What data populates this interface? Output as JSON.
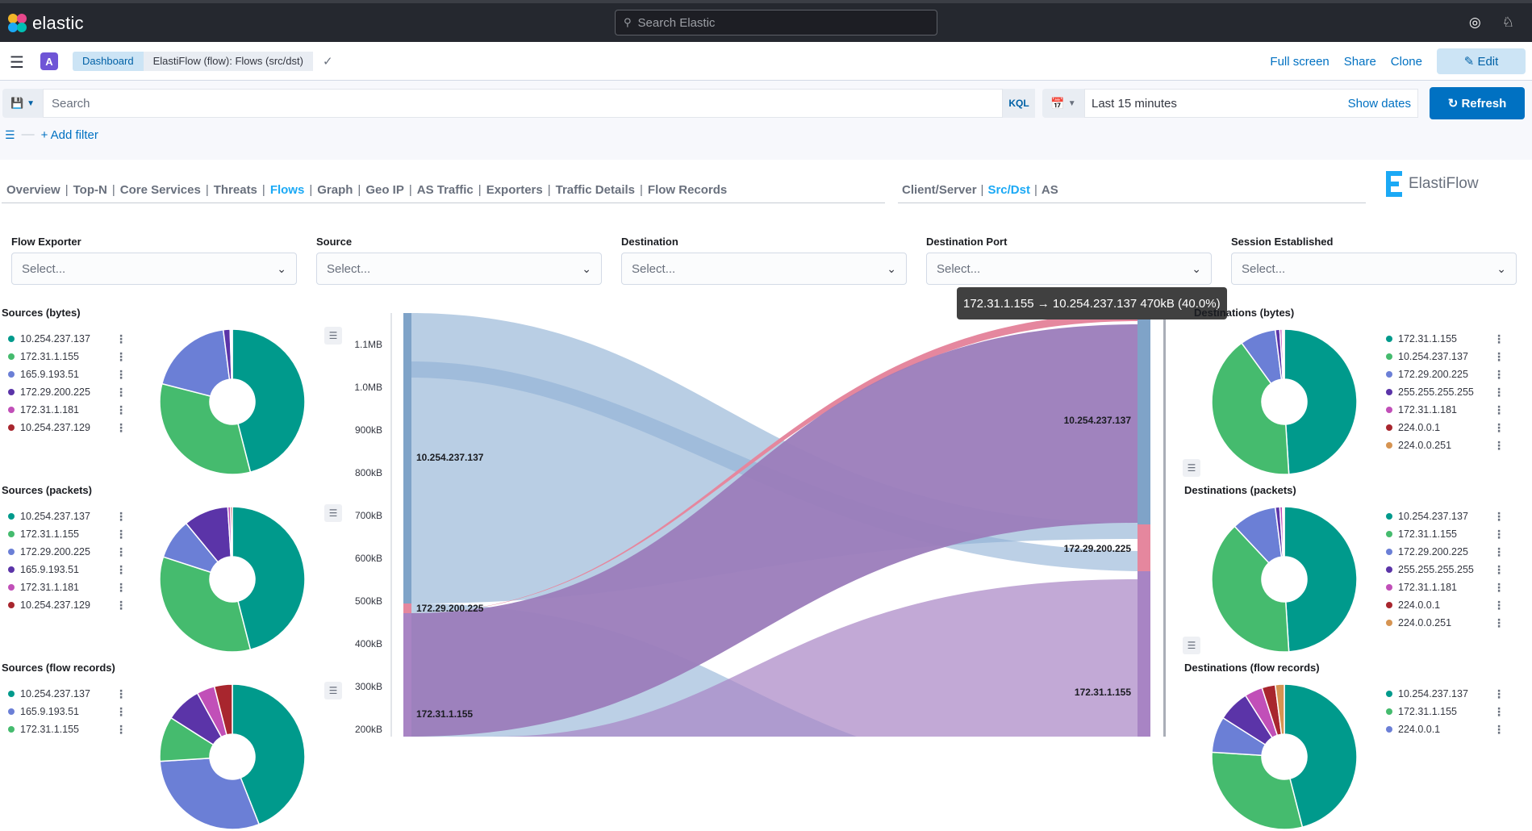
{
  "app": {
    "name": "elastic",
    "search_placeholder": "Search Elastic"
  },
  "header": {
    "space": "A",
    "breadcrumbs": [
      "Dashboard",
      "ElastiFlow (flow): Flows (src/dst)"
    ],
    "actions": {
      "fullscreen": "Full screen",
      "share": "Share",
      "clone": "Clone",
      "edit": "Edit"
    }
  },
  "query": {
    "placeholder": "Search",
    "language": "KQL",
    "time_range": "Last 15 minutes",
    "show_dates": "Show dates",
    "refresh": "Refresh",
    "add_filter": "+ Add filter"
  },
  "nav": {
    "tabs": [
      "Overview",
      "Top-N",
      "Core Services",
      "Threats",
      "Flows",
      "Graph",
      "Geo IP",
      "AS Traffic",
      "Exporters",
      "Traffic Details",
      "Flow Records"
    ],
    "active_tab": "Flows",
    "sub_tabs": [
      "Client/Server",
      "Src/Dst",
      "AS"
    ],
    "active_sub_tab": "Src/Dst",
    "brand": "ElastiFlow"
  },
  "controls": [
    {
      "label": "Flow Exporter",
      "value": "Select..."
    },
    {
      "label": "Source",
      "value": "Select..."
    },
    {
      "label": "Destination",
      "value": "Select..."
    },
    {
      "label": "Destination Port",
      "value": "Select..."
    },
    {
      "label": "Session Established",
      "value": "Select..."
    }
  ],
  "colors": {
    "teal": "#009a8c",
    "green": "#45bb6e",
    "blue": "#6b7fd6",
    "purple": "#5b34a8",
    "magenta": "#c14fb8",
    "darkred": "#a8262e",
    "orange": "#d69452",
    "accent": "#0071c2",
    "sankey_blue": "#b5cbe3",
    "sankey_purple": "#9b7cba",
    "sankey_pink": "#e5879e"
  },
  "left_panels": {
    "bytes": {
      "title": "Sources (bytes)",
      "items": [
        {
          "label": "10.254.237.137",
          "color": "#009a8c",
          "value": 46
        },
        {
          "label": "172.31.1.155",
          "color": "#45bb6e",
          "value": 33
        },
        {
          "label": "165.9.193.51",
          "color": "#6b7fd6",
          "value": 19
        },
        {
          "label": "172.29.200.225",
          "color": "#5b34a8",
          "value": 1.5
        },
        {
          "label": "172.31.1.181",
          "color": "#c14fb8",
          "value": 0.3
        },
        {
          "label": "10.254.237.129",
          "color": "#a8262e",
          "value": 0.2
        }
      ]
    },
    "packets": {
      "title": "Sources (packets)",
      "items": [
        {
          "label": "10.254.237.137",
          "color": "#009a8c",
          "value": 46
        },
        {
          "label": "172.31.1.155",
          "color": "#45bb6e",
          "value": 34
        },
        {
          "label": "172.29.200.225",
          "color": "#6b7fd6",
          "value": 9
        },
        {
          "label": "165.9.193.51",
          "color": "#5b34a8",
          "value": 10
        },
        {
          "label": "172.31.1.181",
          "color": "#c14fb8",
          "value": 0.6
        },
        {
          "label": "10.254.237.129",
          "color": "#a8262e",
          "value": 0.4
        }
      ]
    },
    "records": {
      "title": "Sources (flow records)",
      "items": [
        {
          "label": "10.254.237.137",
          "color": "#009a8c",
          "value": 44
        },
        {
          "label": "165.9.193.51",
          "color": "#6b7fd6",
          "value": 30
        },
        {
          "label": "172.31.1.155",
          "color": "#45bb6e",
          "value": 10
        },
        {
          "label": "",
          "color": "#5b34a8",
          "value": 8
        },
        {
          "label": "",
          "color": "#c14fb8",
          "value": 4
        },
        {
          "label": "",
          "color": "#a8262e",
          "value": 4
        }
      ]
    }
  },
  "right_panels": {
    "bytes": {
      "title": "Destinations (bytes)",
      "items": [
        {
          "label": "172.31.1.155",
          "color": "#009a8c",
          "value": 49
        },
        {
          "label": "10.254.237.137",
          "color": "#45bb6e",
          "value": 41
        },
        {
          "label": "172.29.200.225",
          "color": "#6b7fd6",
          "value": 8
        },
        {
          "label": "255.255.255.255",
          "color": "#5b34a8",
          "value": 1
        },
        {
          "label": "172.31.1.181",
          "color": "#c14fb8",
          "value": 0.5
        },
        {
          "label": "224.0.0.1",
          "color": "#a8262e",
          "value": 0.3
        },
        {
          "label": "224.0.0.251",
          "color": "#d69452",
          "value": 0.2
        }
      ]
    },
    "packets": {
      "title": "Destinations (packets)",
      "items": [
        {
          "label": "10.254.237.137",
          "color": "#009a8c",
          "value": 49
        },
        {
          "label": "172.31.1.155",
          "color": "#45bb6e",
          "value": 39
        },
        {
          "label": "172.29.200.225",
          "color": "#6b7fd6",
          "value": 10
        },
        {
          "label": "255.255.255.255",
          "color": "#5b34a8",
          "value": 1
        },
        {
          "label": "172.31.1.181",
          "color": "#c14fb8",
          "value": 0.6
        },
        {
          "label": "224.0.0.1",
          "color": "#a8262e",
          "value": 0.2
        },
        {
          "label": "224.0.0.251",
          "color": "#d69452",
          "value": 0.2
        }
      ]
    },
    "records": {
      "title": "Destinations (flow records)",
      "items": [
        {
          "label": "10.254.237.137",
          "color": "#009a8c",
          "value": 46
        },
        {
          "label": "172.31.1.155",
          "color": "#45bb6e",
          "value": 30
        },
        {
          "label": "224.0.0.1",
          "color": "#6b7fd6",
          "value": 8
        },
        {
          "label": "",
          "color": "#5b34a8",
          "value": 7
        },
        {
          "label": "",
          "color": "#c14fb8",
          "value": 4
        },
        {
          "label": "",
          "color": "#a8262e",
          "value": 3
        },
        {
          "label": "",
          "color": "#d69452",
          "value": 2
        }
      ]
    }
  },
  "sankey": {
    "y_ticks": [
      "1.1MB",
      "1.0MB",
      "900kB",
      "800kB",
      "700kB",
      "600kB",
      "500kB",
      "400kB",
      "300kB",
      "200kB"
    ],
    "sources": [
      "10.254.237.137",
      "172.29.200.225",
      "172.31.1.155"
    ],
    "destinations": [
      "10.254.237.137",
      "172.29.200.225",
      "172.31.1.155"
    ],
    "tooltip": "172.31.1.155 → 10.254.237.137 470kB (40.0%)"
  }
}
